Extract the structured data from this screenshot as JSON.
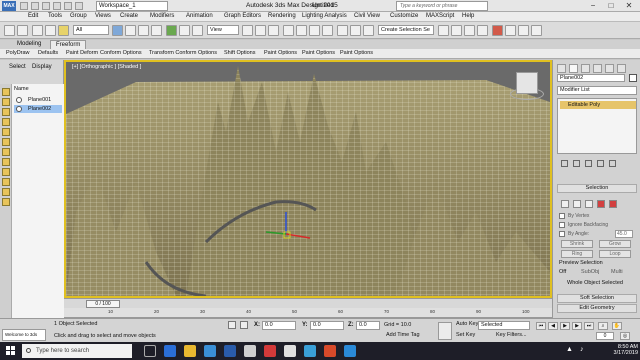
{
  "titlebar": {
    "workspace": "Workspace_1",
    "app_title": "Autodesk 3ds Max Design 2015",
    "file_title": "Untitled",
    "search_placeholder": "Type a keyword or phrase",
    "minimize": "−",
    "maximize": "□",
    "close": "✕"
  },
  "menus": [
    "Edit",
    "Tools",
    "Group",
    "Views",
    "Create",
    "Modifiers",
    "Animation",
    "Graph Editors",
    "Rendering",
    "Lighting Analysis",
    "Civil View",
    "Customize",
    "MAXScript",
    "Help"
  ],
  "toolbar": {
    "filter_dropdown": "All",
    "view_dropdown": "View",
    "named_selection": "Create Selection Se"
  },
  "ribbon": {
    "tabs": [
      "Modeling",
      "Freeform"
    ],
    "active_tab": "Freeform",
    "panels": [
      "PolyDraw",
      "Defaults",
      "Paint Deform",
      "Conform Options",
      "Transform Conform Options",
      "Shift Options",
      "Paint Options",
      "Paint Options",
      "Paint Options"
    ]
  },
  "scene_explorer": {
    "tabs": [
      "Select",
      "Display"
    ],
    "column_header": "Name",
    "items": [
      {
        "name": "Plane001",
        "selected": false
      },
      {
        "name": "Plane002",
        "selected": true
      }
    ]
  },
  "viewport": {
    "label": "[+] [Orthographic ] [Shaded ]"
  },
  "command_panel": {
    "object_name": "Plane002",
    "modifier_list": "Modifier List",
    "stack_item": "Editable Poly",
    "selection_rollout": "Selection",
    "checkboxes": [
      "By Vertex",
      "Ignore Backfacing",
      "By Angle:"
    ],
    "angle_value": "45.0",
    "buttons": [
      "Shrink",
      "Grow",
      "Ring",
      "Loop"
    ],
    "preview_label": "Preview Selection",
    "preview_options": [
      "Off",
      "SubObj",
      "Multi"
    ],
    "whole_object": "Whole Object Selected",
    "soft_selection": "Soft Selection",
    "edit_geometry": "Edit Geometry"
  },
  "timeline": {
    "slider": "0 / 100",
    "ticks": [
      "10",
      "20",
      "30",
      "40",
      "50",
      "60",
      "70",
      "80",
      "90",
      "100"
    ]
  },
  "statusbar": {
    "maxscript": "Welcome to 3ds",
    "selection_count": "1 Object Selected",
    "prompt": "Click and drag to select and move objects",
    "x_label": "X:",
    "x_value": "0.0",
    "y_label": "Y:",
    "y_value": "0.0",
    "z_label": "Z:",
    "z_value": "0.0",
    "grid": "Grid = 10.0",
    "add_time_tag": "Add Time Tag",
    "auto_key": "Auto Key",
    "selected_dropdown": "Selected",
    "set_key": "Set Key",
    "key_filters": "Key Filters...",
    "frame": "0"
  },
  "taskbar": {
    "search_placeholder": "Type here to search",
    "time": "8:50 AM",
    "date": "3/17/2019"
  }
}
